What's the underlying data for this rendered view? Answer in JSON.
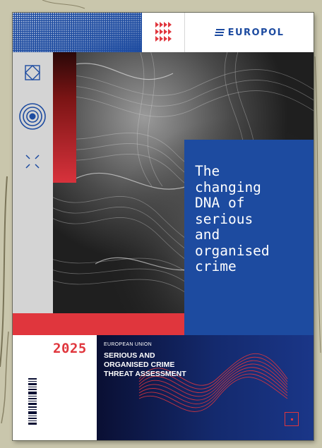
{
  "cover": {
    "brand": "EUROPOL",
    "title_lines": [
      "The",
      "changing",
      "DNA of",
      "serious",
      "and",
      "organised",
      "crime"
    ],
    "year": "2025",
    "publisher": "EUROPEAN UNION",
    "report_lines": [
      "SERIOUS AND",
      "ORGANISED CRIME",
      "THREAT ASSESSMENT"
    ],
    "icons": [
      "diamond-square-icon",
      "concentric-circles-icon",
      "corners-x-icon",
      "chevrons-icon",
      "wave-lines-icon",
      "square-dot-icon",
      "barcode-icon"
    ]
  },
  "colors": {
    "blue": "#1d4ba0",
    "red": "#e0363d",
    "navy": "#0a0f33",
    "grey": "#d4d4d4",
    "background": "#c9c6ac"
  }
}
